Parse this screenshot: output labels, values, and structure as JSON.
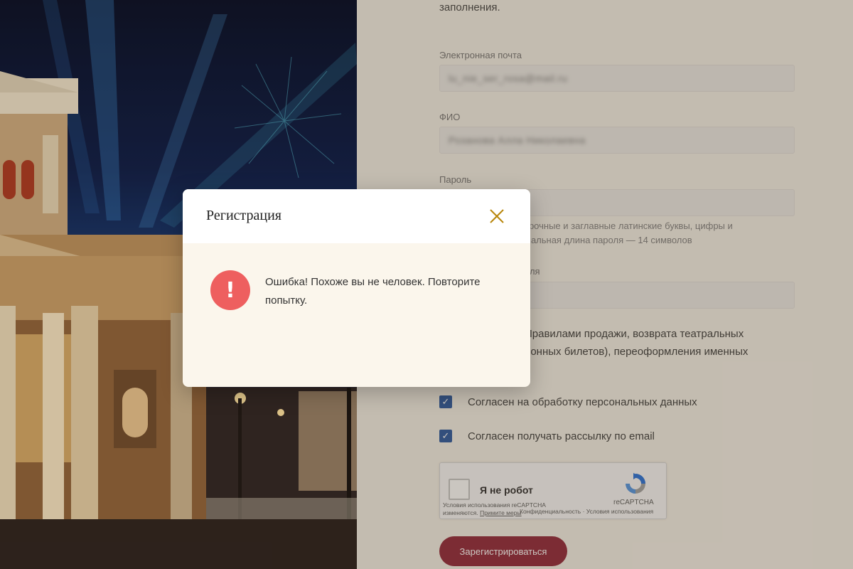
{
  "form": {
    "intro_tail": "заполнения.",
    "email": {
      "label": "Электронная почта",
      "value": "lu_nie_ser_rosa@mail.ru"
    },
    "fio": {
      "label": "ФИО",
      "value": "Розанова Алла Николаевна"
    },
    "password": {
      "label": "Пароль",
      "hint_line1": "трочные и заглавные латинские буквы, цифры и",
      "hint_line2": "мальная длина пароля — 14 символов"
    },
    "confirm_label_tail": "оля",
    "rules_line1": "Правилами продажи, возврата театральных",
    "rules_line2": "ронных билетов), переоформления именных",
    "consent_personal": "Согласен на обработку персональных данных",
    "consent_email": "Согласен получать рассылку по email",
    "recaptcha": {
      "label": "Я не робот",
      "brand": "reCAPTCHA",
      "terms_line1": "Условия использования reCAPTCHA",
      "terms_line2": "изменяются.",
      "terms_link": "Примите меры",
      "privacy": "Конфиденциальность · Условия использования"
    },
    "submit_label": "Зарегистрироваться"
  },
  "modal": {
    "title": "Регистрация",
    "icon": "error-exclamation-icon",
    "icon_glyph": "!",
    "message": "Ошибка! Похоже вы не человек. Повторите попытку."
  },
  "colors": {
    "accent": "#8c1b2f",
    "error": "#ee5f5f",
    "checkbox": "#1f4f9a",
    "close_icon": "#b8860b"
  }
}
